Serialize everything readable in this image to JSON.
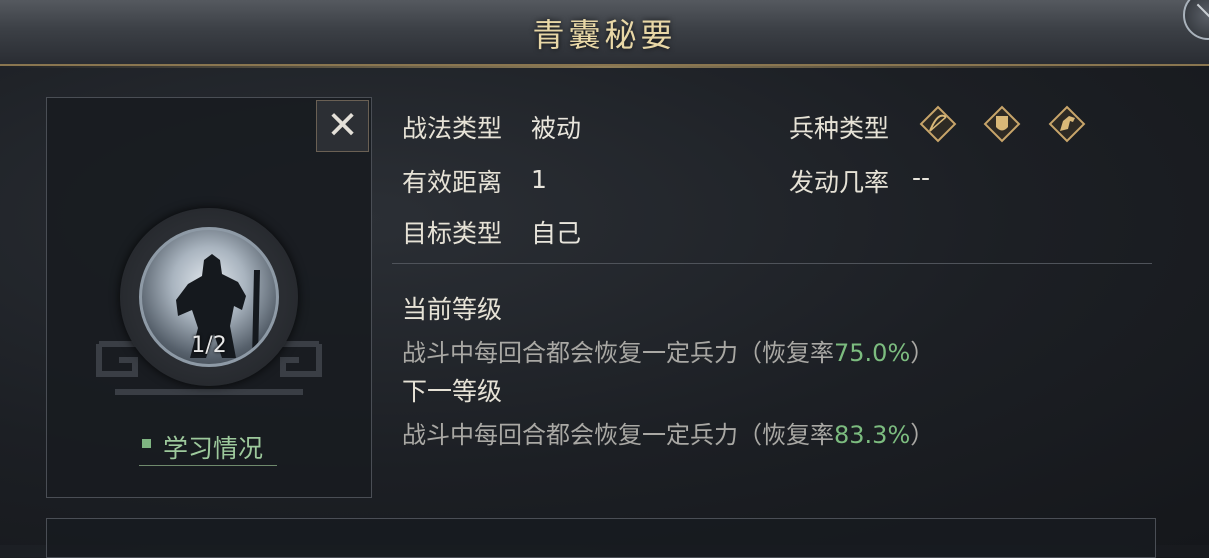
{
  "window": {
    "title": "青囊秘要"
  },
  "skill": {
    "progress": "1/2",
    "study_label": "学习情况",
    "fields": {
      "tactic_type_label": "战法类型",
      "tactic_type_value": "被动",
      "range_label": "有效距离",
      "range_value": "1",
      "target_label": "目标类型",
      "target_value": "自己",
      "troop_label": "兵种类型",
      "troop_icons": [
        "bow-icon",
        "shield-icon",
        "horse-icon"
      ],
      "chance_label": "发动几率",
      "chance_value": "--"
    },
    "current_level": {
      "title": "当前等级",
      "desc_prefix": "战斗中每回合都会恢复一定兵力（恢复率",
      "rate": "75.0%",
      "desc_suffix": "）"
    },
    "next_level": {
      "title": "下一等级",
      "desc_prefix": "战斗中每回合都会恢复一定兵力（恢复率",
      "rate": "83.3%",
      "desc_suffix": "）"
    }
  },
  "colors": {
    "accent_gold": "#e8d7a6",
    "highlight_green": "#7cbc7f"
  }
}
